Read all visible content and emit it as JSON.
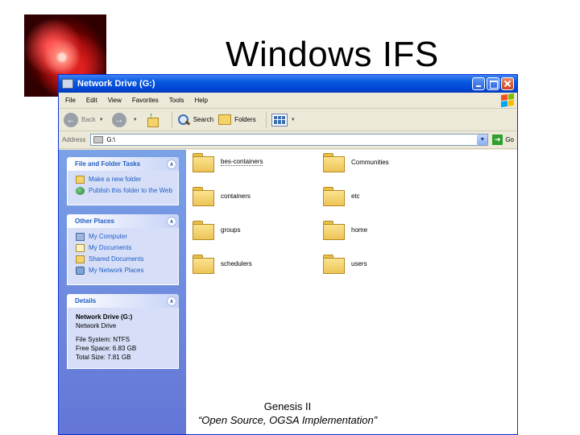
{
  "slide": {
    "title": "Windows IFS",
    "caption_line1": "Genesis II",
    "caption_line2": "“Open Source, OGSA Implementation”"
  },
  "window": {
    "title": "Network Drive (G:)",
    "menu": [
      "File",
      "Edit",
      "View",
      "Favorites",
      "Tools",
      "Help"
    ],
    "toolbar": {
      "back": "Back",
      "search": "Search",
      "folders": "Folders"
    },
    "address": {
      "label": "Address",
      "value": "G:\\",
      "go": "Go"
    }
  },
  "taskpane": {
    "tasks": {
      "title": "File and Folder Tasks",
      "items": [
        "Make a new folder",
        "Publish this folder to the Web"
      ]
    },
    "places": {
      "title": "Other Places",
      "items": [
        "My Computer",
        "My Documents",
        "Shared Documents",
        "My Network Places"
      ]
    },
    "details": {
      "title": "Details",
      "name": "Network Drive (G:)",
      "type": "Network Drive",
      "fs": "File System: NTFS",
      "free": "Free Space: 6.83 GB",
      "total": "Total Size: 7.81 GB"
    }
  },
  "files": [
    "bes-containers",
    "Communities",
    "containers",
    "etc",
    "groups",
    "home",
    "schedulers",
    "users"
  ],
  "colors": {
    "titlebar": "#0758e0",
    "taskpane": "#6f8fdf",
    "link": "#215dc6"
  }
}
